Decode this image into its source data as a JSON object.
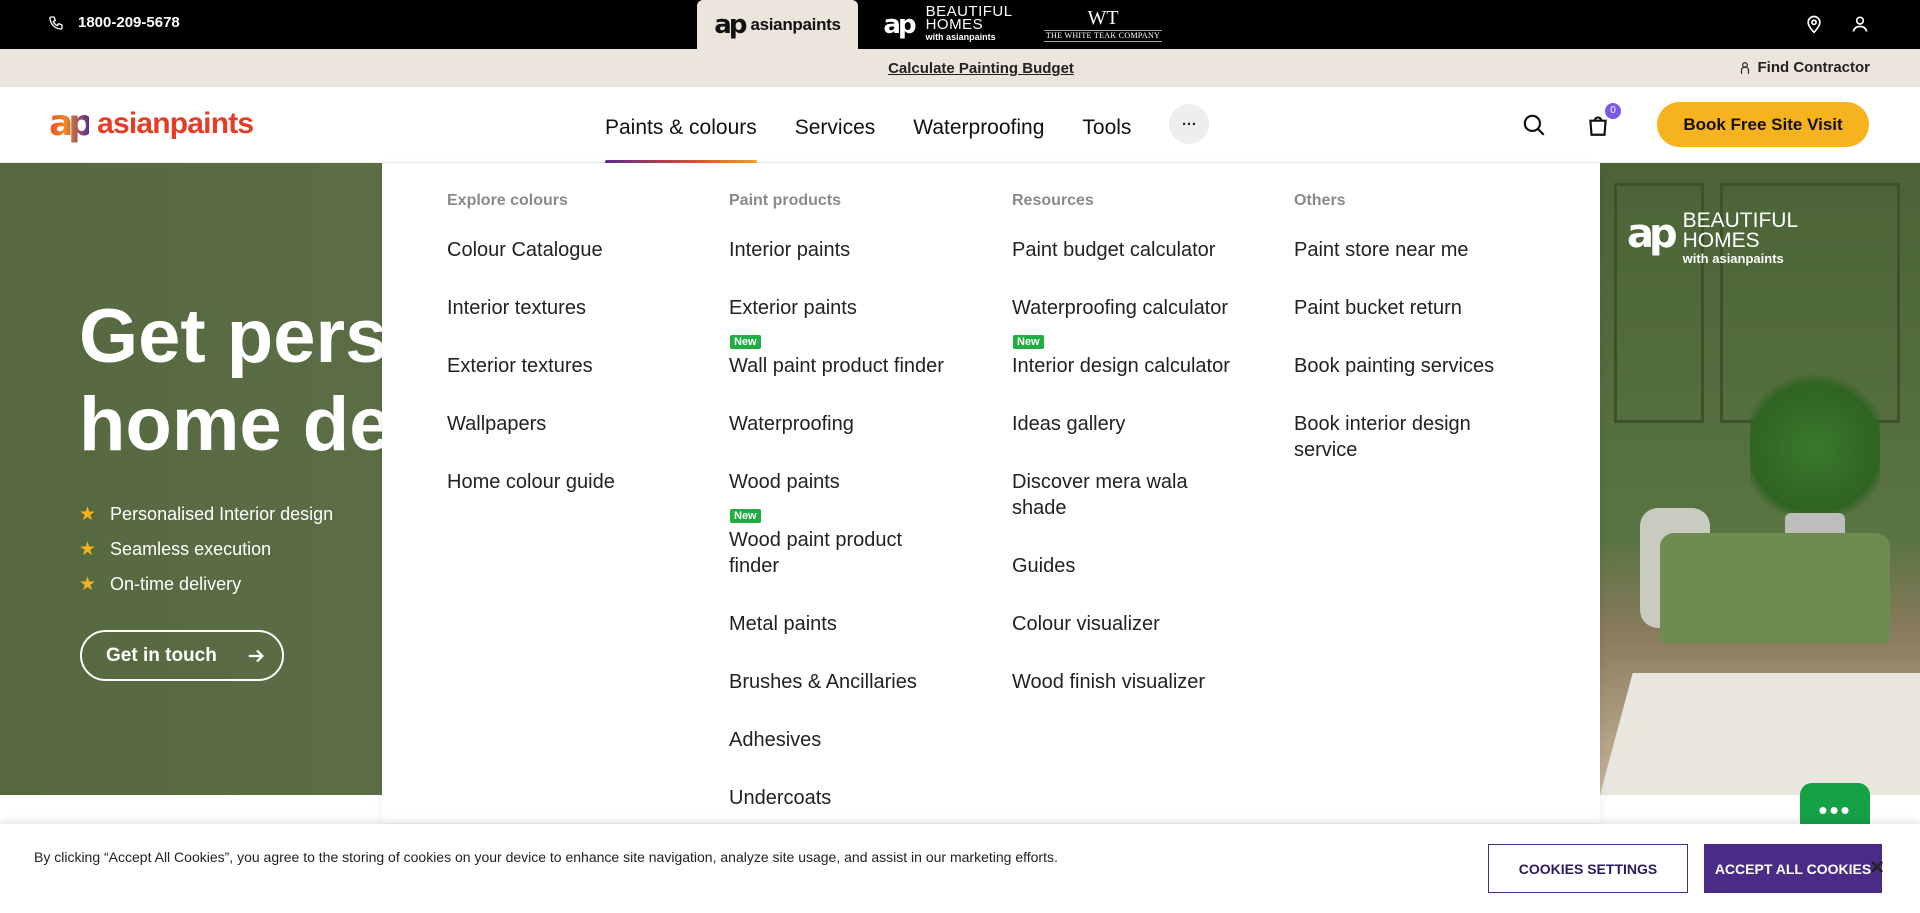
{
  "topbar": {
    "phone": "1800-209-5678",
    "brands": {
      "asianpaints_mark": "ap",
      "asianpaints_word": "asianpaints",
      "bh_mark": "ap",
      "bh_line1": "BEAUTIFUL",
      "bh_line2": "HOMES",
      "bh_line3": "with asianpaints",
      "wt_mono": "WT",
      "wt_name": "THE WHITE TEAK COMPANY"
    },
    "icons": [
      "phone-icon",
      "location-icon",
      "user-icon"
    ]
  },
  "subbar": {
    "budget_link": "Calculate Painting Budget",
    "contractor_link": "Find Contractor"
  },
  "header": {
    "logo_mark": "ap",
    "logo_word": "asianpaints",
    "nav": [
      "Paints & colours",
      "Services",
      "Waterproofing",
      "Tools"
    ],
    "more_label": "···",
    "cart_count": "0",
    "cta": "Book Free Site Visit"
  },
  "hero": {
    "title_line1": "Get pers",
    "title_line2": "home de",
    "bullets": [
      "Personalised Interior design",
      "Seamless execution",
      "On-time delivery"
    ],
    "cta": "Get in touch",
    "right_logo": {
      "mark": "ap",
      "line1": "BEAUTIFUL",
      "line2": "HOMES",
      "line3": "with asianpaints"
    }
  },
  "mega_menu": {
    "columns": [
      {
        "heading": "Explore colours",
        "items": [
          {
            "label": "Colour Catalogue"
          },
          {
            "label": "Interior textures"
          },
          {
            "label": "Exterior textures"
          },
          {
            "label": "Wallpapers"
          },
          {
            "label": "Home colour guide"
          }
        ]
      },
      {
        "heading": "Paint products",
        "items": [
          {
            "label": "Interior paints"
          },
          {
            "label": "Exterior paints"
          },
          {
            "label": "Wall paint product finder",
            "badge": "New"
          },
          {
            "label": "Waterproofing"
          },
          {
            "label": "Wood paints"
          },
          {
            "label": "Wood paint product finder",
            "badge": "New"
          },
          {
            "label": "Metal paints"
          },
          {
            "label": "Brushes & Ancillaries"
          },
          {
            "label": "Adhesives"
          },
          {
            "label": "Undercoats"
          }
        ]
      },
      {
        "heading": "Resources",
        "items": [
          {
            "label": "Paint budget calculator"
          },
          {
            "label": "Waterproofing calculator"
          },
          {
            "label": "Interior design calculator",
            "badge": "New"
          },
          {
            "label": "Ideas gallery"
          },
          {
            "label": "Discover mera wala shade"
          },
          {
            "label": "Guides"
          },
          {
            "label": "Colour visualizer"
          },
          {
            "label": "Wood finish visualizer"
          }
        ]
      },
      {
        "heading": "Others",
        "items": [
          {
            "label": "Paint store near me"
          },
          {
            "label": "Paint bucket return"
          },
          {
            "label": "Book painting services"
          },
          {
            "label": "Book interior design service"
          }
        ]
      }
    ]
  },
  "cookie": {
    "text": "By clicking “Accept All Cookies”, you agree to the storing of cookies on your device to enhance site navigation, analyze site usage, and assist in our marketing efforts.",
    "settings": "COOKIES SETTINGS",
    "accept": "ACCEPT ALL COOKIES",
    "close": "×"
  },
  "colors": {
    "accent": "#f7b31d",
    "brand_red": "#e53d25",
    "brand_purple": "#4a2b87",
    "new_badge": "#1fae44",
    "hero_green": "#55683f"
  }
}
